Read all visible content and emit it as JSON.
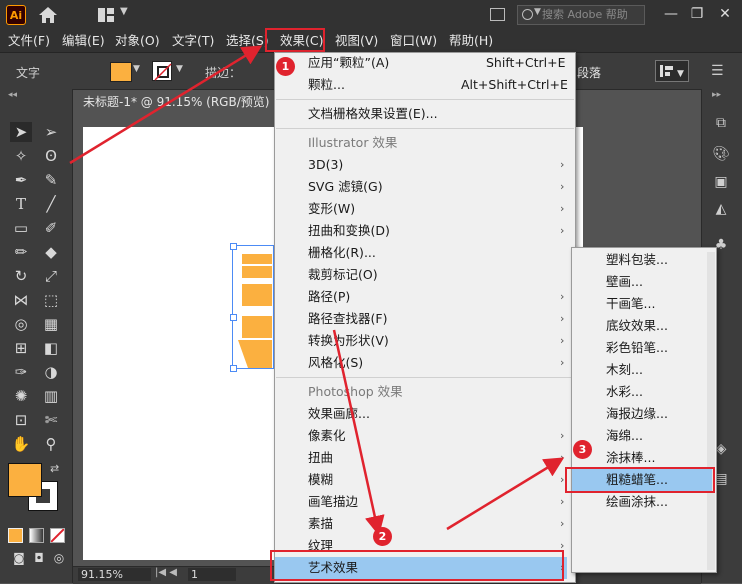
{
  "titlebar": {
    "app_logo": "Ai",
    "search_placeholder": "搜索 Adobe 帮助",
    "icons": [
      "home-icon",
      "workspace-layout-icon",
      "arrange-documents-icon",
      "search-icon",
      "minimize-icon",
      "restore-icon",
      "close-icon"
    ]
  },
  "menubar": {
    "items": [
      "文件(F)",
      "编辑(E)",
      "对象(O)",
      "文字(T)",
      "选择(S)",
      "效果(C)",
      "视图(V)",
      "窗口(W)",
      "帮助(H)"
    ]
  },
  "controlbar": {
    "tool_label": "文字",
    "stroke_label": "描边：",
    "paragraph_label": "段落",
    "colors": {
      "fill": "#fbb040",
      "stroke": "#ffffff"
    }
  },
  "document": {
    "tab_title": "未标题-1* @ 91.15% (RGB/预览)",
    "zoom": "91.15%",
    "page": "1"
  },
  "effect_menu": {
    "apply_last": {
      "label": "应用“颗粒”(A)",
      "shortcut": "Shift+Ctrl+E"
    },
    "last_effect": {
      "label": "颗粒...",
      "shortcut": "Alt+Shift+Ctrl+E"
    },
    "raster_settings": "文档栅格效果设置(E)...",
    "illustrator_header": "Illustrator 效果",
    "illustrator_items": [
      "3D(3)",
      "SVG 滤镜(G)",
      "变形(W)",
      "扭曲和变换(D)",
      "栅格化(R)...",
      "裁剪标记(O)",
      "路径(P)",
      "路径查找器(F)",
      "转换为形状(V)",
      "风格化(S)"
    ],
    "illustrator_has_sub": [
      true,
      true,
      true,
      true,
      false,
      false,
      true,
      true,
      true,
      true
    ],
    "photoshop_header": "Photoshop 效果",
    "photoshop_items": [
      "效果画廊...",
      "像素化",
      "扭曲",
      "模糊",
      "画笔描边",
      "素描",
      "纹理",
      "艺术效果"
    ],
    "photoshop_has_sub": [
      false,
      true,
      true,
      true,
      true,
      true,
      true,
      true
    ]
  },
  "art_submenu": {
    "items": [
      "塑料包装...",
      "壁画...",
      "干画笔...",
      "底纹效果...",
      "彩色铅笔...",
      "木刻...",
      "水彩...",
      "海报边缘...",
      "海绵...",
      "涂抹棒...",
      "粗糙蜡笔...",
      "绘画涂抹..."
    ],
    "selected": "粗糙蜡笔..."
  },
  "annotations": {
    "markers": [
      "1",
      "2",
      "3"
    ],
    "highlight_color": "#e0232e"
  }
}
